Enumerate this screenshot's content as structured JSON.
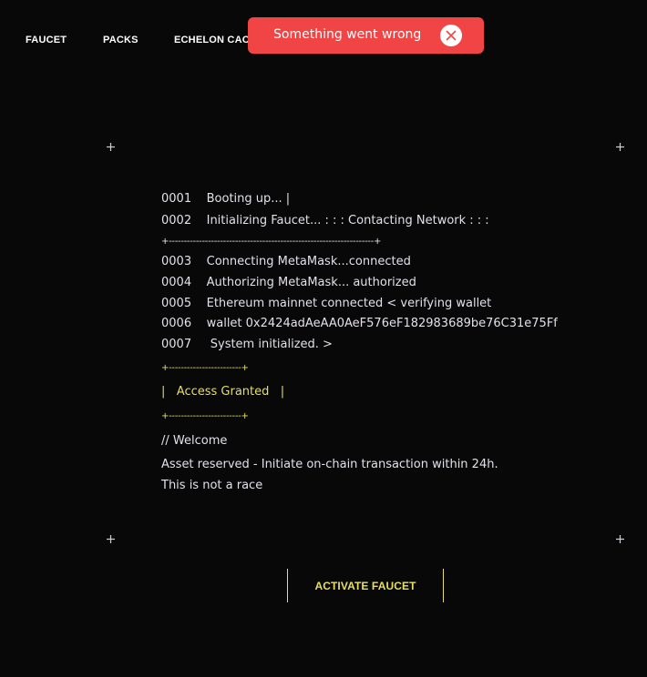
{
  "nav": {
    "items": [
      "FAUCET",
      "PACKS",
      "ECHELON CAC"
    ]
  },
  "toast": {
    "message": "Something went wrong",
    "icon": "close-circle-icon",
    "color": "#f04445"
  },
  "terminal": {
    "lines": [
      "0001    Booting up... |",
      "0002    Initializing Faucet... : : : Contacting Network : : :",
      "0003    Connecting MetaMask...connected",
      "0004    Authorizing MetaMask... authorized",
      "0005    Ethereum mainnet connected < verifying wallet",
      "0006    wallet 0x2424adAeAA0AeF576eF182983689be76C31e75Ff",
      "0007     System initialized. >"
    ],
    "separator": "+--------------------------------------------------------------------+",
    "box_border": "+------------------------+",
    "access_granted": "|   Access Granted   |",
    "welcome": "// Welcome",
    "message_lines": [
      "Asset reserved - Initiate on-chain transaction within 24h.",
      "This is not a race"
    ]
  },
  "action": {
    "label": "ACTIVATE FAUCET"
  },
  "colors": {
    "background": "#080808",
    "accent": "#e6df62",
    "text": "#e4dfea",
    "error": "#f04445"
  }
}
